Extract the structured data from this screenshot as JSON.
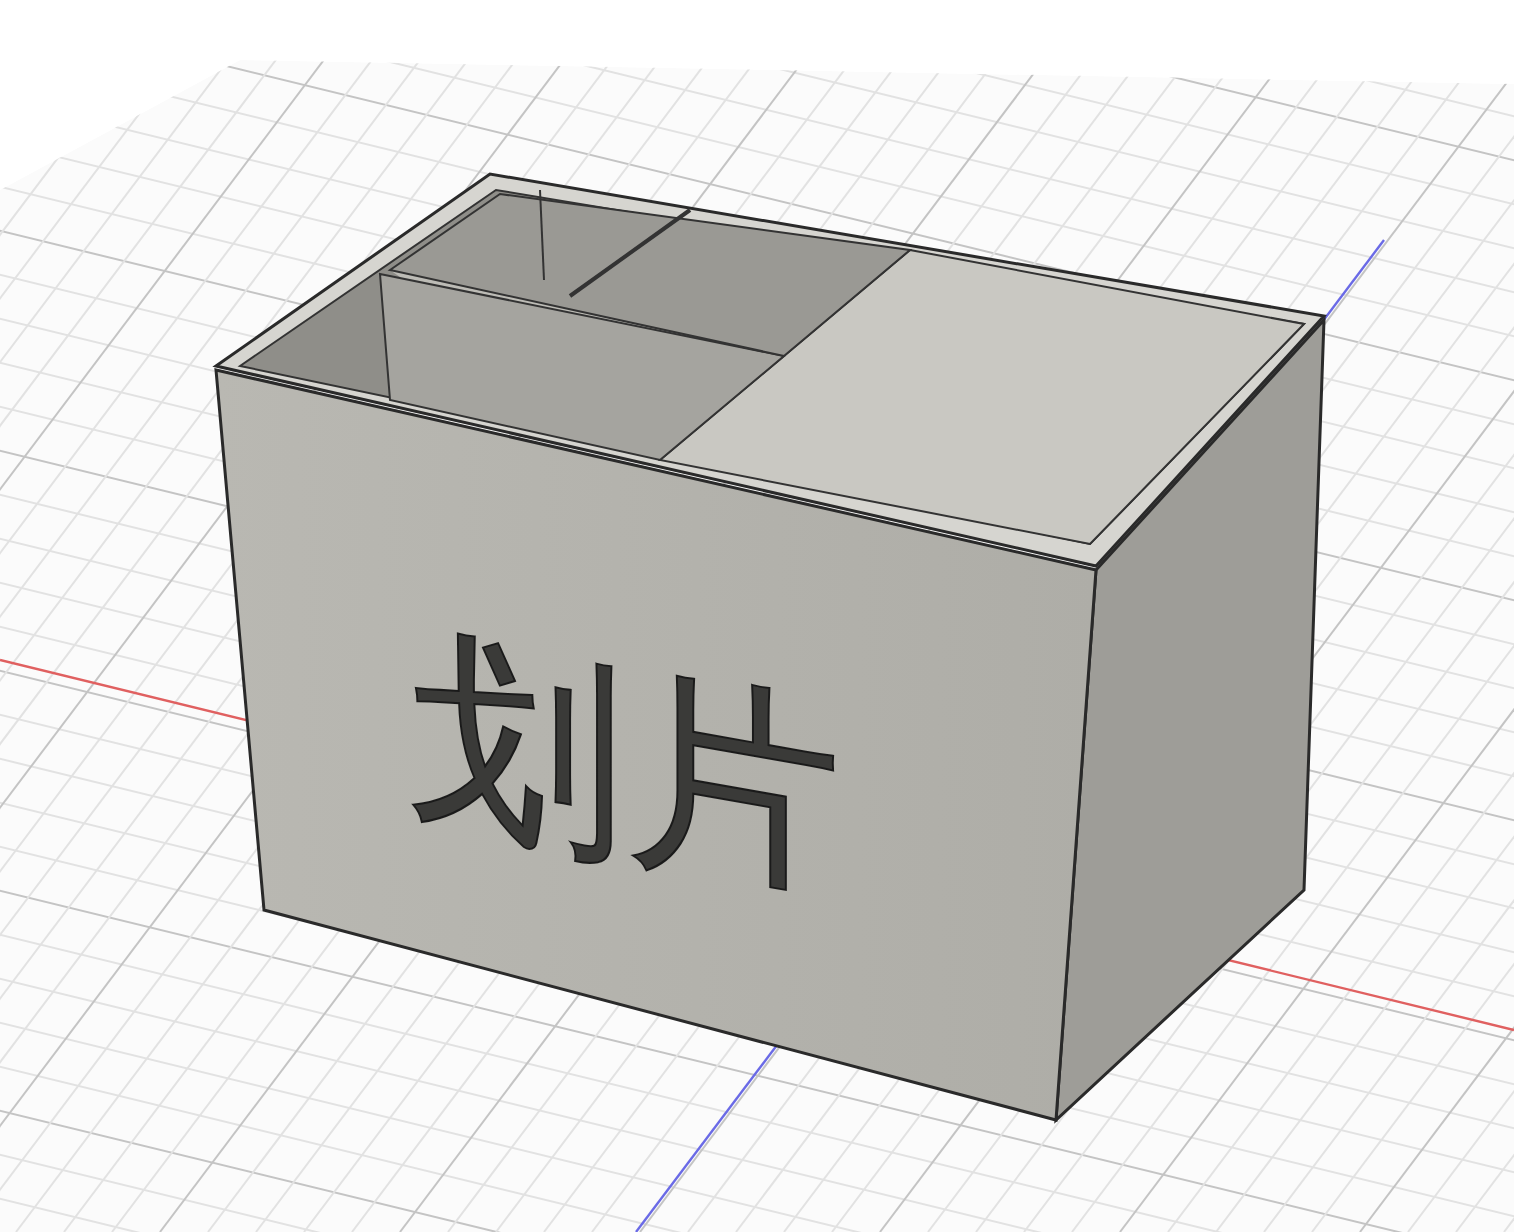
{
  "viewport": {
    "model": {
      "engraved_text": "划片"
    }
  }
}
